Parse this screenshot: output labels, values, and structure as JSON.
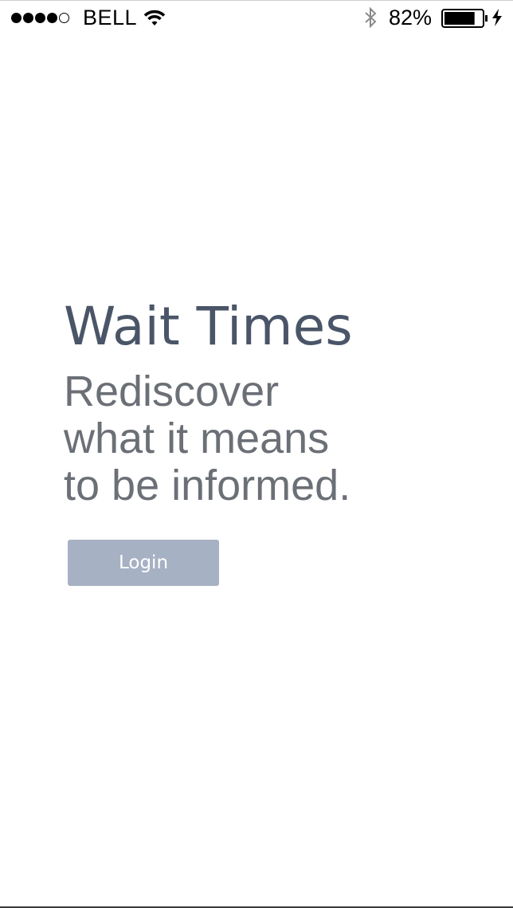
{
  "status_bar": {
    "signal_full": 4,
    "signal_empty": 1,
    "carrier": "BELL",
    "battery_percent_label": "82%",
    "battery_level": 0.82,
    "icons": [
      "wifi-icon",
      "bluetooth-icon",
      "battery-icon",
      "charging-bolt-icon"
    ]
  },
  "main": {
    "title": "Wait Times",
    "tagline": [
      "Rediscover",
      "what it means",
      "to be informed."
    ],
    "login_label": "Login"
  },
  "colors": {
    "title": "#4a5568",
    "tagline": "#6b6f76",
    "button_bg": "#a6b1c3",
    "button_text": "#ffffff"
  }
}
